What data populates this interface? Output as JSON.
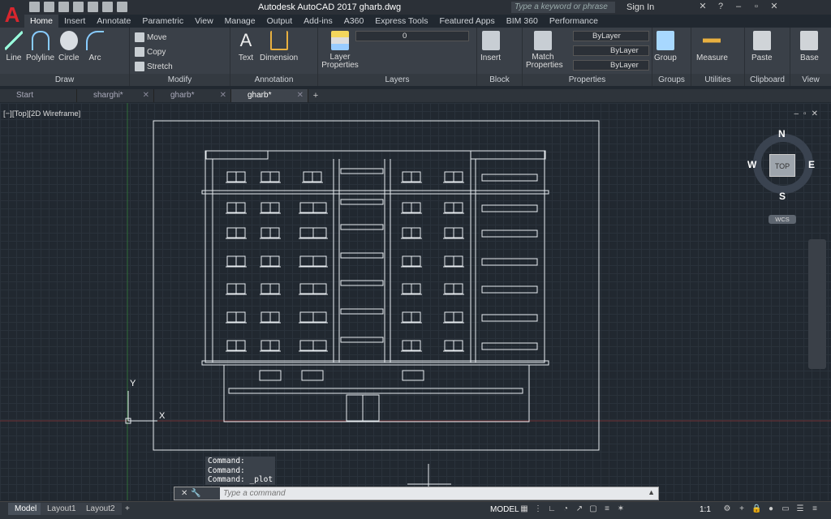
{
  "app": {
    "logo_letter": "A",
    "title": "Autodesk AutoCAD 2017    gharb.dwg"
  },
  "search": {
    "placeholder": "Type a keyword or phrase"
  },
  "account": {
    "signin": "Sign In"
  },
  "ribbon_tabs": [
    "Home",
    "Insert",
    "Annotate",
    "Parametric",
    "View",
    "Manage",
    "Output",
    "Add-ins",
    "A360",
    "Express Tools",
    "Featured Apps",
    "BIM 360",
    "Performance"
  ],
  "panels": {
    "draw": {
      "label": "Draw",
      "line": "Line",
      "polyline": "Polyline",
      "circle": "Circle",
      "arc": "Arc"
    },
    "modify": {
      "label": "Modify",
      "move": "Move",
      "copy": "Copy",
      "stretch": "Stretch"
    },
    "annotation": {
      "label": "Annotation",
      "text": "Text",
      "dimension": "Dimension"
    },
    "layers": {
      "label": "Layers",
      "properties": "Layer Properties",
      "current_layer": "0"
    },
    "block": {
      "label": "Block",
      "insert": "Insert"
    },
    "properties": {
      "label": "Properties",
      "match": "Match Properties",
      "color": "ByLayer",
      "linetype": "ByLayer",
      "lineweight": "ByLayer"
    },
    "groups": {
      "label": "Groups",
      "group": "Group"
    },
    "utilities": {
      "label": "Utilities",
      "measure": "Measure"
    },
    "clipboard": {
      "label": "Clipboard",
      "paste": "Paste"
    },
    "view": {
      "label": "View",
      "base": "Base"
    }
  },
  "doc_tabs": [
    "Start",
    "sharghi*",
    "gharb*",
    "gharb*"
  ],
  "viewport": {
    "label": "[−][Top][2D Wireframe]"
  },
  "viewcube": {
    "top": "TOP",
    "n": "N",
    "s": "S",
    "e": "E",
    "w": "W",
    "wcs": "WCS"
  },
  "ucs": {
    "x": "X",
    "y": "Y"
  },
  "command": {
    "history": [
      "Command:",
      "Command:",
      "Command: _plot"
    ],
    "placeholder": "Type a command"
  },
  "layouts": [
    "Model",
    "Layout1",
    "Layout2"
  ],
  "status": {
    "model": "MODEL",
    "scale": "1:1"
  },
  "colors": {
    "background": "#212830",
    "ribbon": "#3a4048",
    "logo": "#d8262e"
  }
}
